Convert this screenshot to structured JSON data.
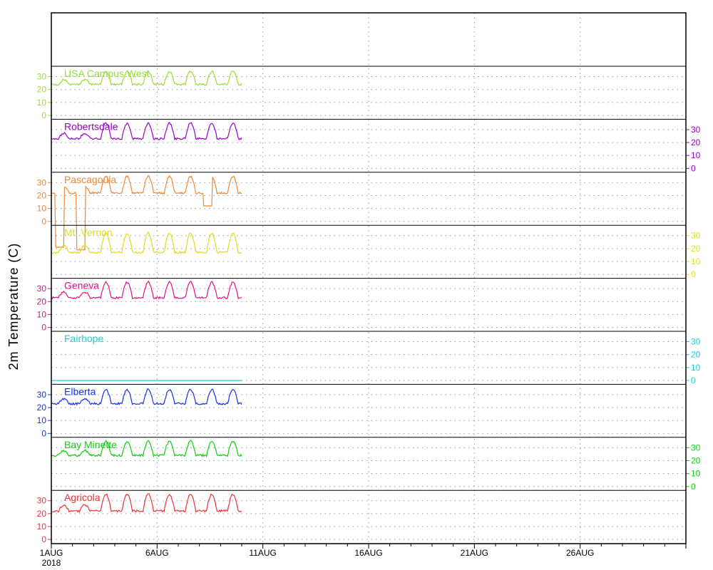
{
  "chart_data": {
    "type": "line",
    "ylabel": "2m Temperature (C)",
    "xlim": [
      "2018-08-01",
      "2018-08-31"
    ],
    "x_ticks": [
      {
        "label": "1AUG",
        "date": "2018-08-01",
        "sublabel": "2018"
      },
      {
        "label": "6AUG",
        "date": "2018-08-06"
      },
      {
        "label": "11AUG",
        "date": "2018-08-11"
      },
      {
        "label": "16AUG",
        "date": "2018-08-16"
      },
      {
        "label": "21AUG",
        "date": "2018-08-21"
      },
      {
        "label": "26AUG",
        "date": "2018-08-26"
      }
    ],
    "y_ticks": [
      0,
      10,
      20,
      30
    ],
    "grid": true,
    "stations": [
      {
        "name": "USA Campus West",
        "color": "#99dd33",
        "axis": "left",
        "lo": 24,
        "hi": 34
      },
      {
        "name": "Robertsdale",
        "color": "#9900cc",
        "axis": "right",
        "lo": 23,
        "hi": 35
      },
      {
        "name": "Pascagoula",
        "color": "#ee8833",
        "axis": "left",
        "lo": 22,
        "hi": 35,
        "anomalies": [
          {
            "date": "2018-08-01",
            "value": -20
          },
          {
            "date": "2018-08-02",
            "value": -22
          },
          {
            "date": "2018-08-08",
            "value": 12
          }
        ]
      },
      {
        "name": "Mt. Vernon",
        "color": "#dddd22",
        "axis": "right",
        "lo": 17,
        "hi": 32
      },
      {
        "name": "Geneva",
        "color": "#dd1188",
        "axis": "left",
        "lo": 23,
        "hi": 35
      },
      {
        "name": "Fairhope",
        "color": "#22cccc",
        "axis": "right",
        "lo": 0,
        "hi": 0,
        "flat": true
      },
      {
        "name": "Elberta",
        "color": "#1133ee",
        "axis": "left",
        "lo": 23,
        "hi": 34
      },
      {
        "name": "Bay Minette",
        "color": "#11cc11",
        "axis": "right",
        "lo": 24,
        "hi": 35
      },
      {
        "name": "Agricola",
        "color": "#ee3333",
        "axis": "left",
        "lo": 22,
        "hi": 35
      }
    ],
    "data_start": "2018-08-01",
    "data_end": "2018-08-10"
  }
}
